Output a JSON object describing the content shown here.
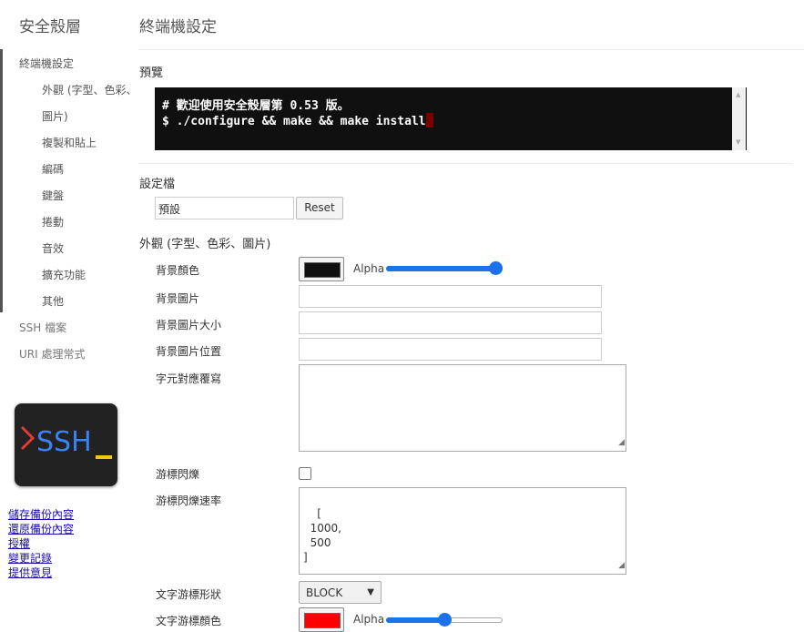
{
  "sidebar": {
    "app_title": "安全殼層",
    "items": [
      {
        "label": "終端機設定"
      },
      {
        "label": "外觀 (字型、色彩、"
      },
      {
        "label": "圖片)"
      },
      {
        "label": "複製和貼上"
      },
      {
        "label": "編碼"
      },
      {
        "label": "鍵盤"
      },
      {
        "label": "捲動"
      },
      {
        "label": "音效"
      },
      {
        "label": "擴充功能"
      },
      {
        "label": "其他"
      },
      {
        "label": "SSH 檔案"
      },
      {
        "label": "URI 處理常式"
      }
    ],
    "logo_text": "SSH",
    "links": [
      "儲存備份內容",
      "還原備份內容",
      "授權",
      "變更記錄",
      "提供意見"
    ]
  },
  "main": {
    "title": "終端機設定",
    "preview_title": "預覽",
    "terminal": {
      "line1": "# 歡迎使用安全殼層第 0.53 版。",
      "line2": "$ ./configure && make && make install"
    },
    "profile_title": "設定檔",
    "profile_value": "預設",
    "reset_label": "Reset",
    "appearance_title": "外觀 (字型、色彩、圖片)",
    "fields": {
      "bg_color": "背景顏色",
      "alpha": "Alpha",
      "bg_image": "背景圖片",
      "bg_image_size": "背景圖片大小",
      "bg_image_position": "背景圖片位置",
      "char_map": "字元對應覆寫",
      "cursor_blink": "游標閃爍",
      "cursor_blink_cycle": "游標閃爍速率",
      "cursor_blink_cycle_value": "[\n  1000,\n  500\n]",
      "cursor_shape": "文字游標形狀",
      "cursor_shape_value": "BLOCK",
      "cursor_color": "文字游標顏色"
    },
    "colors": {
      "bg_color": "#101010",
      "cursor_color": "#ff0000",
      "accent": "#1a73e8"
    },
    "bg_alpha": 1.0,
    "cursor_alpha": 0.5
  }
}
